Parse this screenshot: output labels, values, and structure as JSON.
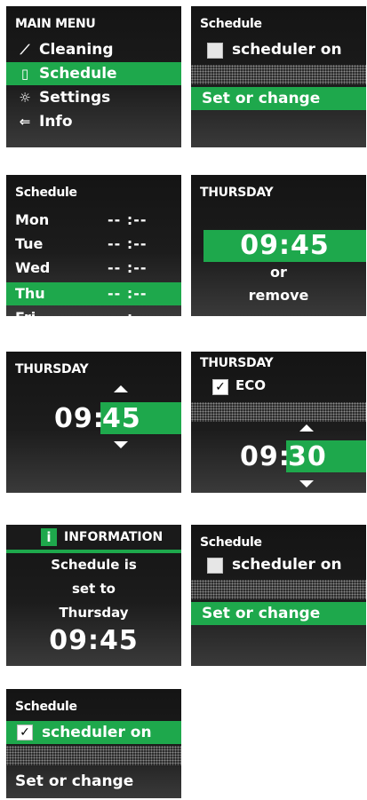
{
  "main_menu": {
    "title": "MAIN MENU",
    "items": [
      {
        "label": "Cleaning",
        "icon": "broom-icon",
        "glyph": "⟋"
      },
      {
        "label": "Schedule",
        "icon": "calendar-icon",
        "glyph": "▯"
      },
      {
        "label": "Settings",
        "icon": "gear-icon",
        "glyph": "☼"
      },
      {
        "label": "Info",
        "icon": "info-icon",
        "glyph": "⇐"
      }
    ],
    "selected": "Schedule"
  },
  "schedule_off": {
    "title": "Schedule",
    "checkbox_label": "scheduler on",
    "action": "Set or change"
  },
  "schedule_days": {
    "title": "Schedule",
    "days": [
      {
        "name": "Mon",
        "time": "-- :--"
      },
      {
        "name": "Tue",
        "time": "-- :--"
      },
      {
        "name": "Wed",
        "time": "-- :--"
      },
      {
        "name": "Thu",
        "time": "-- :--"
      },
      {
        "name": "Fri",
        "time": "-- :--"
      }
    ],
    "selected": "Thu"
  },
  "thursday_time": {
    "title": "THURSDAY",
    "time": "09:45",
    "or_label": "or",
    "remove_label": "remove"
  },
  "thursday_edit": {
    "title": "THURSDAY",
    "hours": "09:",
    "minutes": "45"
  },
  "thursday_eco": {
    "title": "THURSDAY",
    "eco_label": "ECO",
    "hours": "09:",
    "minutes": "30"
  },
  "information": {
    "title": "INFORMATION",
    "line1": "Schedule is",
    "line2": "set to",
    "line3": "Thursday",
    "time": "09:45"
  },
  "schedule_off_2": {
    "title": "Schedule",
    "checkbox_label": "scheduler on",
    "action": "Set or change"
  },
  "schedule_on": {
    "title": "Schedule",
    "checkbox_label": "scheduler on",
    "checkmark": "✓",
    "action": "Set or change"
  },
  "colors": {
    "accent": "#1ea84c",
    "screen": "#1a1a1a"
  }
}
